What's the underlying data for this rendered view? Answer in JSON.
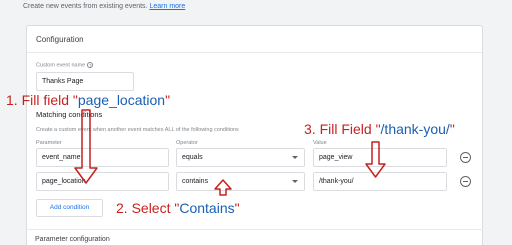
{
  "top_note": {
    "text": "Create new events from existing events.",
    "link": "Learn more"
  },
  "configuration": {
    "title": "Configuration",
    "custom_event_name_label": "Custom event name",
    "help_icon_glyph": "?",
    "custom_event_name_value": "Thanks Page"
  },
  "matching": {
    "title": "Matching conditions",
    "description": "Create a custom event when another event matches ALL of the following conditions",
    "headers": {
      "parameter": "Parameter",
      "operator": "Operator",
      "value": "Value"
    },
    "rows": [
      {
        "parameter": "event_name",
        "operator": "equals",
        "value": "page_view"
      },
      {
        "parameter": "page_location",
        "operator": "contains",
        "value": "/thank-you/"
      }
    ],
    "add_condition_label": "Add condition"
  },
  "parameter_configuration": {
    "title": "Parameter configuration"
  },
  "annotations": {
    "step1": {
      "prefix": "1. Fill field \"",
      "value": "page_location",
      "suffix": "\""
    },
    "step2": {
      "prefix": "2. Select \"",
      "value": "Contains",
      "suffix": "\""
    },
    "step3": {
      "prefix": "3. Fill Field \"",
      "value": "/thank-you/",
      "suffix": "\""
    }
  },
  "colors": {
    "annotation_red": "#c5221f",
    "annotation_blue": "#1a5fb4",
    "link_blue": "#1a73e8"
  },
  "icons": {
    "help": "help-icon",
    "remove": "remove-circle-icon",
    "dropdown": "chevron-down-icon",
    "arrow": "arrow-icon"
  }
}
